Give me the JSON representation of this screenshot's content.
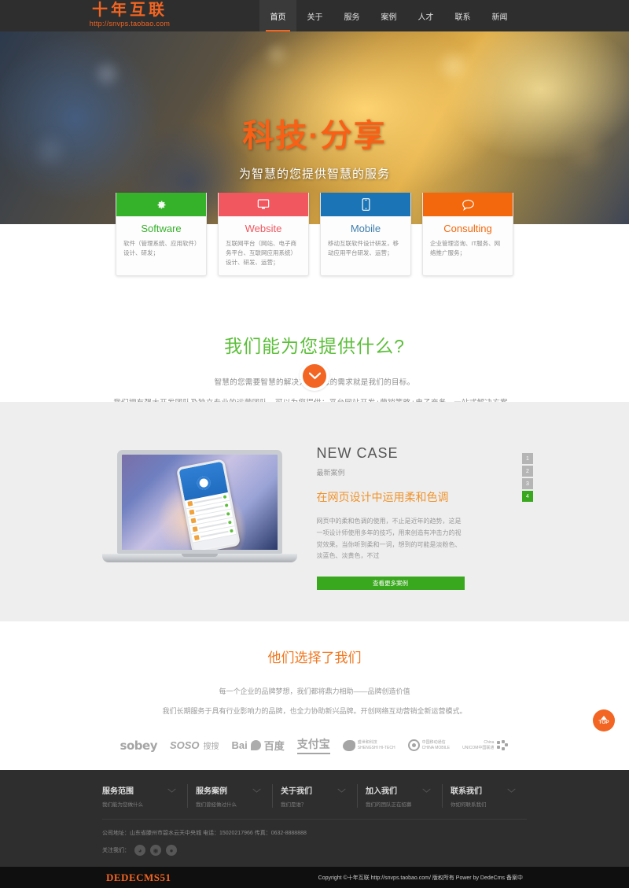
{
  "header": {
    "logo_text": "十年互联",
    "logo_url": "http://snvps.taobao.com",
    "nav": [
      {
        "label": "首页",
        "active": true
      },
      {
        "label": "关于",
        "active": false
      },
      {
        "label": "服务",
        "active": false
      },
      {
        "label": "案例",
        "active": false
      },
      {
        "label": "人才",
        "active": false
      },
      {
        "label": "联系",
        "active": false
      },
      {
        "label": "新闻",
        "active": false
      }
    ]
  },
  "hero": {
    "title": "科技·分享",
    "subtitle": "为智慧的您提供智慧的服务",
    "title_color": "#f4611a"
  },
  "cards": [
    {
      "title": "Software",
      "desc": "软件（管理系统、应用软件）设计、研发；",
      "color": "#36b12a",
      "icon": "gear-icon"
    },
    {
      "title": "Website",
      "desc": "互联网平台（网站、电子商务平台、互联网应用系统）设计、研发、运营；",
      "color": "#f0575f",
      "icon": "monitor-icon"
    },
    {
      "title": "Mobile",
      "desc": "移动互联软件设计研发，移动应用平台研发、运营；",
      "color": "#1b74b5",
      "icon": "mobile-icon"
    },
    {
      "title": "Consulting",
      "desc": "企业管理咨询、IT服务、网络推广服务；",
      "color": "#f3680d",
      "icon": "chat-icon"
    }
  ],
  "offer": {
    "title": "我们能为您提供什么?",
    "p1": "智慧的您需要智慧的解决方案，您的需求就是我们的目标。",
    "p2": "我们拥有强大开发团队及独立专业的运营团队，可以为您提供：平台网站开发+营销策略+电子商务，一站式解决方案。",
    "title_color": "#5cbf3a"
  },
  "case": {
    "heading": "NEW CASE",
    "sub": "最新案例",
    "title": "在网页设计中运用柔和色调",
    "text": "网页中的柔和色调的使用，不止是近年的趋势，这是一项设计师使用多年的技巧，用来创造有冲击力的视觉效果。当你听到柔和一词，想到的可能是淡粉色、淡蓝色、淡黄色，不过",
    "button": "查看更多案例",
    "pager": [
      "1",
      "2",
      "3",
      "4"
    ],
    "pager_active": "4",
    "accent_color": "#f0932b",
    "button_color": "#3aa81e"
  },
  "clients": {
    "title": "他们选择了我们",
    "p1": "每一个企业的品牌梦想，我们都将鼎力相助——品牌创造价值",
    "p2": "我们长期服务于具有行业影响力的品牌，也全力协助新兴品牌。开创网络互动营销全新运营模式。",
    "title_color": "#f0771f",
    "logos": [
      {
        "name": "sobey",
        "text": "sobey"
      },
      {
        "name": "soso",
        "text": "SOSO",
        "sub": "搜搜"
      },
      {
        "name": "baidu",
        "text": "Bai",
        "sub": "百度"
      },
      {
        "name": "alipay",
        "text": "支付宝"
      },
      {
        "name": "shengshi",
        "text": "盛世和科技",
        "sub": "SHENGSHI HI-TECH"
      },
      {
        "name": "china-mobile",
        "text": "中国移动通信",
        "sub": "CHINA MOBILE"
      },
      {
        "name": "china-unicom",
        "text": "China",
        "sub": "UNICOM中国联通"
      }
    ]
  },
  "footer": {
    "columns": [
      {
        "title": "服务范围",
        "sub": "我们能为您做什么"
      },
      {
        "title": "服务案例",
        "sub": "我们曾经做过什么"
      },
      {
        "title": "关于我们",
        "sub": "我们是谁？"
      },
      {
        "title": "加入我们",
        "sub": "我们的团队正在招募"
      },
      {
        "title": "联系我们",
        "sub": "你如何联系我们"
      }
    ],
    "address": "公司地址：山东省滕州市碧水云天中央城 电话：15020217966 传真：0632-8888888",
    "follow_label": "关注我们：",
    "socials": [
      "weibo-icon",
      "weixin-icon",
      "qq-icon"
    ],
    "to_top_label": "TOP"
  },
  "bottombar": {
    "brand": "DEDECMS51",
    "copyright": "Copyright ©十年互联 http://snvps.taobao.com/ 版权所有 Power by DedeCms 备案中"
  }
}
